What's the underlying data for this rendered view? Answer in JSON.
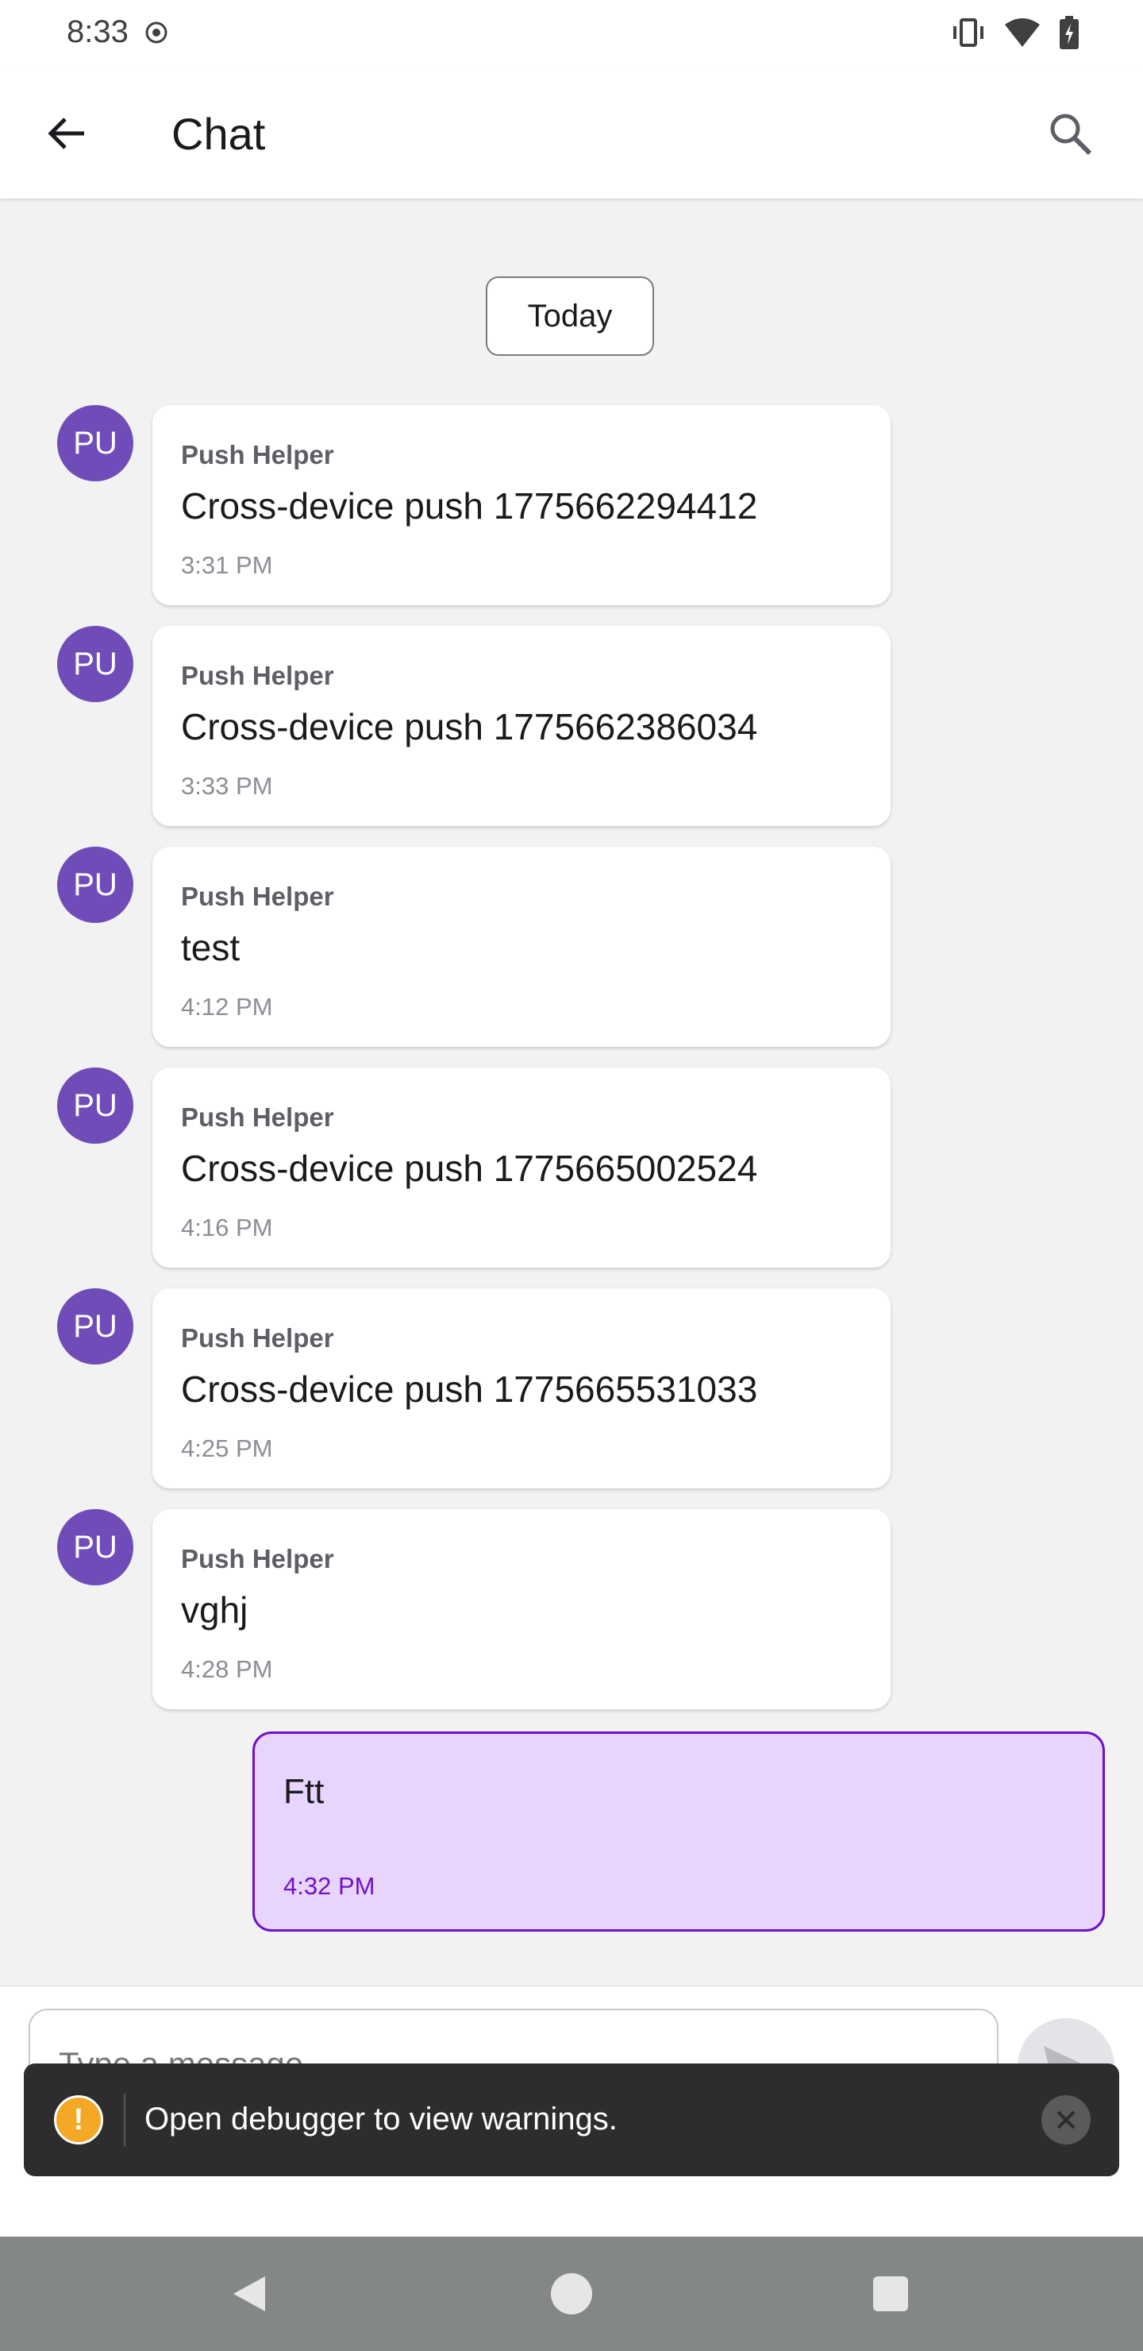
{
  "status_bar": {
    "time": "8:33"
  },
  "app_bar": {
    "title": "Chat"
  },
  "date_chip": "Today",
  "messages": [
    {
      "avatar": "PU",
      "sender": "Push Helper",
      "text": "Cross-device push 1775662294412",
      "time": "3:31 PM"
    },
    {
      "avatar": "PU",
      "sender": "Push Helper",
      "text": "Cross-device push 1775662386034",
      "time": "3:33 PM"
    },
    {
      "avatar": "PU",
      "sender": "Push Helper",
      "text": "test",
      "time": "4:12 PM"
    },
    {
      "avatar": "PU",
      "sender": "Push Helper",
      "text": "Cross-device push 1775665002524",
      "time": "4:16 PM"
    },
    {
      "avatar": "PU",
      "sender": "Push Helper",
      "text": "Cross-device push 1775665531033",
      "time": "4:25 PM"
    },
    {
      "avatar": "PU",
      "sender": "Push Helper",
      "text": "vghj",
      "time": "4:28 PM"
    }
  ],
  "sent_message": {
    "text": "Ftt",
    "time": "4:32 PM"
  },
  "composer": {
    "placeholder": "Type a message"
  },
  "toast": {
    "text": "Open debugger to view warnings."
  },
  "colors": {
    "avatar": "#6f4cb8",
    "sent_bubble": "#e8d5fd",
    "sent_accent": "#6f12c8",
    "warning": "#f4a825"
  }
}
